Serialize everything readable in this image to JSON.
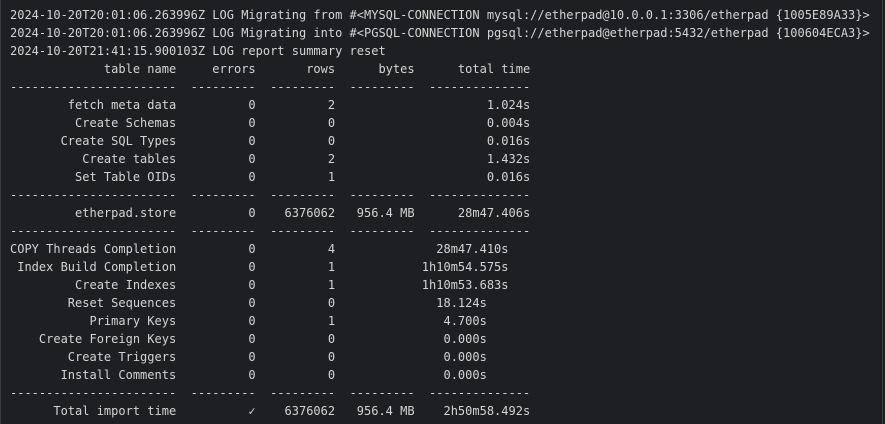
{
  "terminal": {
    "lines": [
      "2024-10-20T20:01:06.263996Z LOG Migrating from #<MYSQL-CONNECTION mysql://etherpad@10.0.0.1:3306/etherpad {1005E89A33}>",
      "2024-10-20T20:01:06.263996Z LOG Migrating into #<PGSQL-CONNECTION pgsql://etherpad@etherpad:5432/etherpad {100604ECA3}>",
      "2024-10-20T21:41:15.900103Z LOG report summary reset",
      "             table name     errors       rows      bytes      total time",
      "-----------------------  ---------  ---------  ---------  --------------",
      "        fetch meta data          0          2                     1.024s",
      "         Create Schemas          0          0                     0.004s",
      "       Create SQL Types          0          0                     0.016s",
      "          Create tables          0          2                     1.432s",
      "         Set Table OIDs          0          1                     0.016s",
      "-----------------------  ---------  ---------  ---------  --------------",
      "         etherpad.store          0    6376062   956.4 MB      28m47.406s",
      "-----------------------  ---------  ---------  ---------  --------------",
      "COPY Threads Completion          0          4              28m47.410s",
      " Index Build Completion          0          1            1h10m54.575s",
      "         Create Indexes          0          1            1h10m53.683s",
      "        Reset Sequences          0          0              18.124s",
      "           Primary Keys          0          1               4.700s",
      "    Create Foreign Keys          0          0               0.000s",
      "        Create Triggers          0          0               0.000s",
      "       Install Comments          0          0               0.000s",
      "-----------------------  ---------  ---------  ---------  --------------",
      "      Total import time          ✓    6376062   956.4 MB    2h50m58.492s"
    ]
  }
}
